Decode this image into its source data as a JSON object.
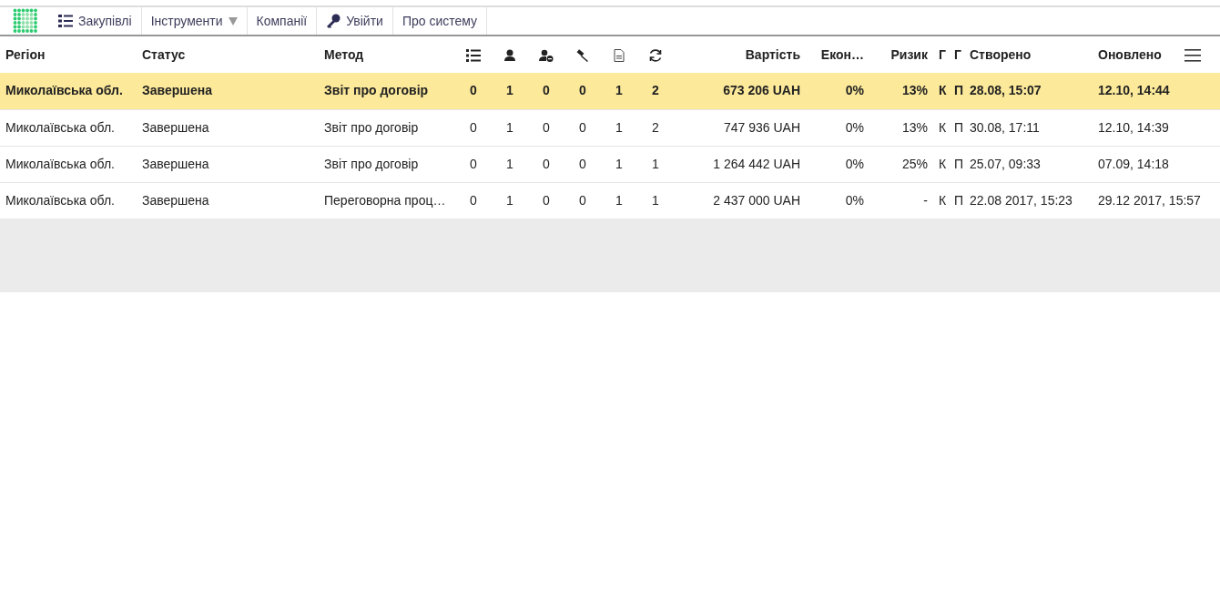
{
  "nav": [
    {
      "label": "Закупівлі",
      "kind": "link"
    },
    {
      "label": "Інструменти",
      "kind": "dropdown"
    },
    {
      "label": "Компанії",
      "kind": "link"
    },
    {
      "label": "Увійти",
      "kind": "link"
    },
    {
      "label": "Про систему",
      "kind": "link"
    }
  ],
  "table": {
    "columns": [
      {
        "kind": "text",
        "label": "Регіон"
      },
      {
        "kind": "text",
        "label": "Статус"
      },
      {
        "kind": "text",
        "label": "Метод"
      },
      {
        "kind": "icon"
      },
      {
        "kind": "icon"
      },
      {
        "kind": "icon"
      },
      {
        "kind": "icon"
      },
      {
        "kind": "icon"
      },
      {
        "kind": "icon"
      },
      {
        "kind": "text",
        "label": "Вартість"
      },
      {
        "kind": "text",
        "label": "Екон…"
      },
      {
        "kind": "text",
        "label": "Ризик"
      },
      {
        "kind": "text",
        "label": "Г"
      },
      {
        "kind": "text",
        "label": "Г"
      },
      {
        "kind": "text",
        "label": "Створено"
      },
      {
        "kind": "text",
        "label": "Оновлено"
      },
      {
        "kind": "menu"
      }
    ],
    "rows": [
      {
        "selected": true,
        "cells": [
          "Миколаївська обл.",
          "Завершена",
          "Звіт про договір",
          "0",
          "1",
          "0",
          "0",
          "1",
          "2",
          "673 206 UAH",
          "0%",
          "13%",
          "К",
          "П",
          "28.08, 15:07",
          "12.10, 14:44"
        ]
      },
      {
        "selected": false,
        "cells": [
          "Миколаївська обл.",
          "Завершена",
          "Звіт про договір",
          "0",
          "1",
          "0",
          "0",
          "1",
          "2",
          "747 936 UAH",
          "0%",
          "13%",
          "К",
          "П",
          "30.08, 17:11",
          "12.10, 14:39"
        ]
      },
      {
        "selected": false,
        "cells": [
          "Миколаївська обл.",
          "Завершена",
          "Звіт про договір",
          "0",
          "1",
          "0",
          "0",
          "1",
          "1",
          "1 264 442 UAH",
          "0%",
          "25%",
          "К",
          "П",
          "25.07, 09:33",
          "07.09, 14:18"
        ]
      },
      {
        "selected": false,
        "cells": [
          "Миколаївська обл.",
          "Завершена",
          "Переговорна проц…",
          "0",
          "1",
          "0",
          "0",
          "1",
          "1",
          "2 437 000 UAH",
          "0%",
          "-",
          "К",
          "П",
          "22.08 2017, 15:23",
          "29.12 2017, 15:57"
        ]
      }
    ]
  }
}
